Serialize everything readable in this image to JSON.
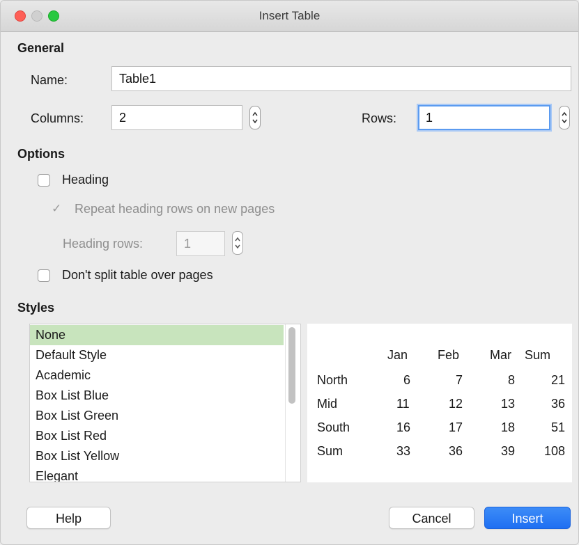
{
  "window": {
    "title": "Insert Table"
  },
  "general": {
    "heading": "General",
    "name_label": "Name:",
    "name_value": "Table1",
    "columns_label": "Columns:",
    "columns_value": "2",
    "rows_label": "Rows:",
    "rows_value": "1"
  },
  "options": {
    "heading": "Options",
    "heading_checkbox_label": "Heading",
    "heading_checked": false,
    "repeat_label": "Repeat heading rows on new pages",
    "repeat_checked": true,
    "heading_rows_label": "Heading rows:",
    "heading_rows_value": "1",
    "dont_split_label": "Don't split table over pages",
    "dont_split_checked": false
  },
  "styles": {
    "heading": "Styles",
    "selected_index": 0,
    "items": [
      "None",
      "Default Style",
      "Academic",
      "Box List Blue",
      "Box List Green",
      "Box List Red",
      "Box List Yellow",
      "Elegant"
    ]
  },
  "preview": {
    "columns": [
      "",
      "Jan",
      "Feb",
      "Mar",
      "Sum"
    ],
    "rows": [
      [
        "North",
        "6",
        "7",
        "8",
        "21"
      ],
      [
        "Mid",
        "11",
        "12",
        "13",
        "36"
      ],
      [
        "South",
        "16",
        "17",
        "18",
        "51"
      ],
      [
        "Sum",
        "33",
        "36",
        "39",
        "108"
      ]
    ]
  },
  "buttons": {
    "help": "Help",
    "cancel": "Cancel",
    "insert": "Insert"
  },
  "colors": {
    "accent": "#1f6ff2",
    "selection": "#c8e4bd",
    "focus_ring": "#5b9bf0"
  }
}
